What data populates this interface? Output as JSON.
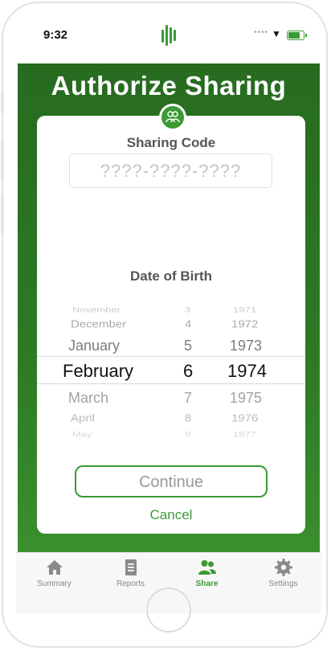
{
  "status_bar": {
    "time": "9:32",
    "signal_dots": "••••",
    "wifi_glyph": "▼"
  },
  "header": {
    "title": "Authorize Sharing",
    "badge_icon": "people-share-icon"
  },
  "sharing_code": {
    "label": "Sharing Code",
    "placeholder": "????-????-????",
    "value": ""
  },
  "dob": {
    "label": "Date of Birth",
    "months": [
      "November",
      "December",
      "January",
      "February",
      "March",
      "April",
      "May"
    ],
    "days": [
      "3",
      "4",
      "5",
      "6",
      "7",
      "8",
      "9"
    ],
    "years": [
      "1971",
      "1972",
      "1973",
      "1974",
      "1975",
      "1976",
      "1977"
    ],
    "selected": {
      "month": "February",
      "day": "6",
      "year": "1974"
    }
  },
  "actions": {
    "continue_label": "Continue",
    "cancel_label": "Cancel"
  },
  "tabs": [
    {
      "label": "Summary",
      "icon": "home-icon",
      "active": false
    },
    {
      "label": "Reports",
      "icon": "document-icon",
      "active": false
    },
    {
      "label": "Share",
      "icon": "people-icon",
      "active": true
    },
    {
      "label": "Settings",
      "icon": "gear-icon",
      "active": false
    }
  ],
  "colors": {
    "brand_green": "#3a9a35",
    "header_green": "#276b20"
  }
}
